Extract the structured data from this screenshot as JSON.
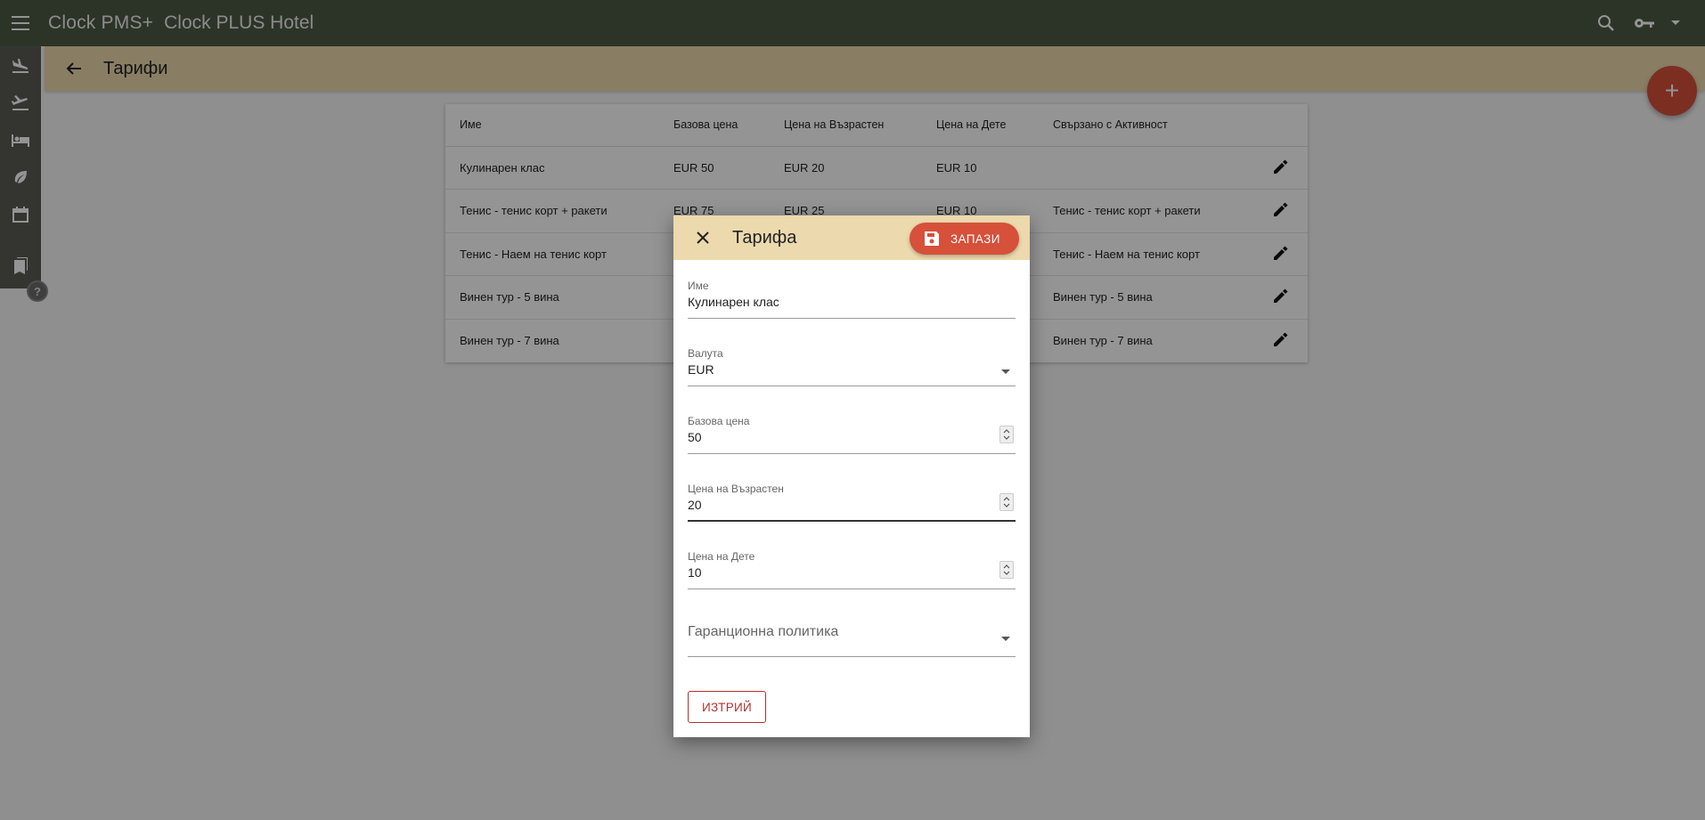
{
  "appbar": {
    "brand": "Clock PMS+",
    "hotel": "Clock PLUS Hotel",
    "icons": [
      "menu-icon",
      "search-icon",
      "key-icon",
      "caret-down-icon"
    ]
  },
  "rail": {
    "icons": [
      "flight-land-icon",
      "flight-takeoff-icon",
      "bed-icon",
      "leaf-icon",
      "calendar-icon",
      "bookmarks-icon",
      "help-icon"
    ],
    "help_label": "?"
  },
  "page": {
    "title": "Тарифи"
  },
  "fab": {
    "label": "+"
  },
  "table": {
    "headers": [
      "Име",
      "Базова цена",
      "Цена на Възрастен",
      "Цена на Дете",
      "Свързано с Активност"
    ],
    "rows": [
      {
        "name": "Кулинарен клас",
        "base": "EUR 50",
        "adult": "EUR 20",
        "child": "EUR 10",
        "activity": ""
      },
      {
        "name": "Тенис - тенис корт + ракети",
        "base": "EUR 75",
        "adult": "EUR 25",
        "child": "EUR 10",
        "activity": "Тенис - тенис корт + ракети"
      },
      {
        "name": "Тенис - Наем на тенис корт",
        "base": "",
        "adult": "",
        "child": "",
        "activity": "Тенис - Наем на тенис корт"
      },
      {
        "name": "Винен тур - 5 вина",
        "base": "",
        "adult": "",
        "child": "",
        "activity": "Винен тур - 5 вина"
      },
      {
        "name": "Винен тур - 7 вина",
        "base": "",
        "adult": "",
        "child": "",
        "activity": "Винен тур - 7 вина"
      }
    ]
  },
  "dialog": {
    "title": "Тарифа",
    "save_label": "ЗАПАЗИ",
    "fields": {
      "name": {
        "label": "Име",
        "value": "Кулинарен клас"
      },
      "currency": {
        "label": "Валута",
        "value": "EUR"
      },
      "base_price": {
        "label": "Базова цена",
        "value": "50"
      },
      "adult_price": {
        "label": "Цена на Възрастен",
        "value": "20"
      },
      "child_price": {
        "label": "Цена на Дете",
        "value": "10"
      },
      "guarantee_policy": {
        "placeholder": "Гаранционна политика"
      }
    },
    "delete_label": "ИЗТРИЙ"
  },
  "colors": {
    "appbar": "#4c5a45",
    "header": "#ecd9ad",
    "accent": "#d6503a",
    "danger": "#b33030"
  }
}
